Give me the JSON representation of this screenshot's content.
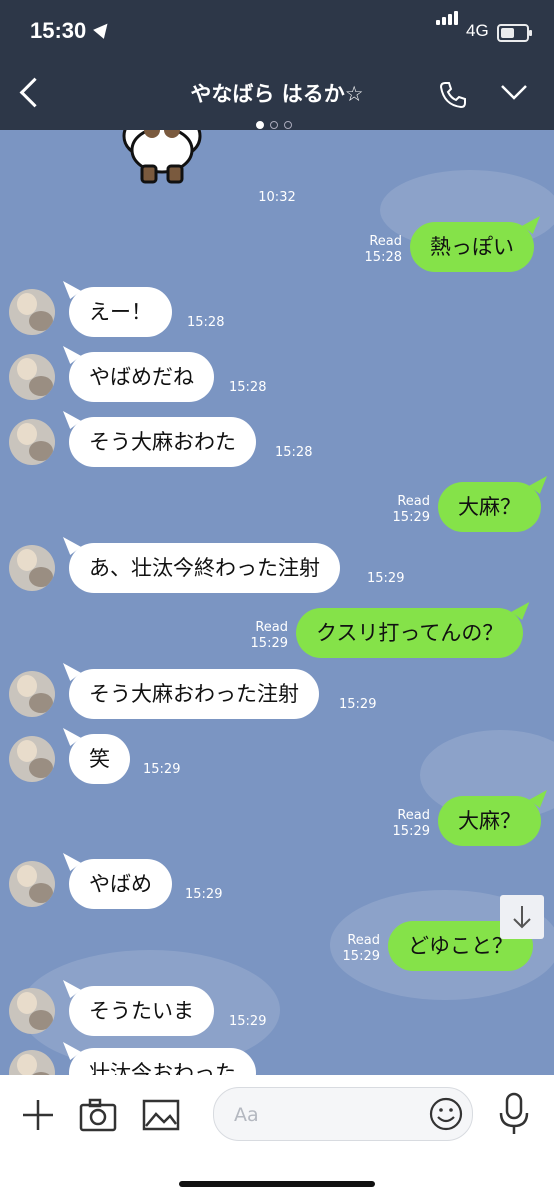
{
  "status_bar": {
    "time": "15:30",
    "network": "4G",
    "battery_level": 0.55
  },
  "header": {
    "title": "やなばら はるか☆",
    "page_dots": 3,
    "active_dot": 1
  },
  "messages": [
    {
      "side": "center",
      "type": "time",
      "time": "10:32"
    },
    {
      "side": "out",
      "text": "熱っぽい",
      "read": "Read",
      "time": "15:28"
    },
    {
      "side": "in",
      "text": "えー！",
      "time": "15:28"
    },
    {
      "side": "in",
      "text": "やばめだね",
      "time": "15:28"
    },
    {
      "side": "in",
      "text": "そう大麻おわた",
      "time": "15:28"
    },
    {
      "side": "out",
      "text": "大麻？",
      "read": "Read",
      "time": "15:29"
    },
    {
      "side": "in",
      "text": "あ、壮汰今終わった注射",
      "time": "15:29"
    },
    {
      "side": "out",
      "text": "クスリ打ってんの？",
      "read": "Read",
      "time": "15:29"
    },
    {
      "side": "in",
      "text": "そう大麻おわった注射",
      "time": "15:29"
    },
    {
      "side": "in",
      "text": "笑",
      "time": "15:29"
    },
    {
      "side": "out",
      "text": "大麻？",
      "read": "Read",
      "time": "15:29"
    },
    {
      "side": "in",
      "text": "やばめ",
      "time": "15:29"
    },
    {
      "side": "out",
      "text": "どゆこと？",
      "read": "Read",
      "time": "15:29"
    },
    {
      "side": "in",
      "text": "そうたいま",
      "time": "15:29"
    },
    {
      "side": "in",
      "text": "壮汰今おわった",
      "time": ""
    }
  ],
  "input": {
    "placeholder": "Aa"
  },
  "icons": {
    "add": "plus-icon",
    "camera": "camera-icon",
    "image": "image-icon",
    "emoji": "smiley-icon",
    "mic": "microphone-icon",
    "call": "phone-icon",
    "menu": "chevron-down-icon",
    "back": "chevron-left-icon",
    "scroll": "arrow-down-icon"
  },
  "colors": {
    "header": "#2d3748",
    "chat_bg": "#7b95c2",
    "outgoing_bubble": "#85e249",
    "incoming_bubble": "#ffffff"
  }
}
